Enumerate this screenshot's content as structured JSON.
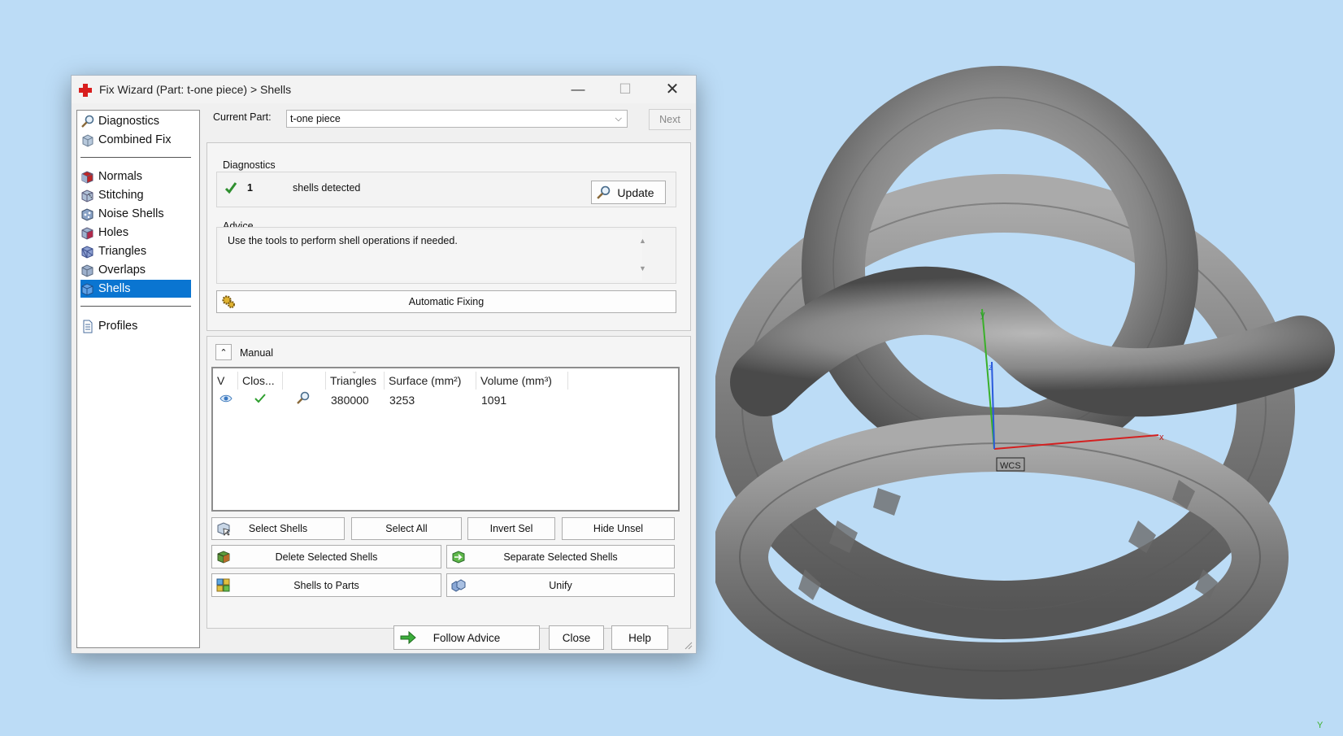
{
  "window": {
    "title": "Fix Wizard (Part: t-one piece) > Shells",
    "controls": {
      "minimize": "—",
      "maximize": "☐",
      "close": "✕"
    }
  },
  "nav": {
    "top": [
      {
        "label": "Diagnostics",
        "icon": "magnifier-icon"
      },
      {
        "label": "Combined Fix",
        "icon": "cube-stack-icon"
      }
    ],
    "tools": [
      {
        "label": "Normals",
        "icon": "normals-cube-icon"
      },
      {
        "label": "Stitching",
        "icon": "stitching-cube-icon"
      },
      {
        "label": "Noise Shells",
        "icon": "noise-shells-icon"
      },
      {
        "label": "Holes",
        "icon": "holes-cube-icon"
      },
      {
        "label": "Triangles",
        "icon": "triangles-cube-icon"
      },
      {
        "label": "Overlaps",
        "icon": "overlaps-cube-icon"
      },
      {
        "label": "Shells",
        "icon": "shells-cube-icon",
        "selected": true
      }
    ],
    "bottom": [
      {
        "label": "Profiles",
        "icon": "document-icon"
      }
    ]
  },
  "current_part": {
    "label": "Current Part:",
    "value": "t-one piece",
    "next": "Next"
  },
  "diagnostics": {
    "heading": "Diagnostics",
    "count": "1",
    "message": "shells detected",
    "update_button": "Update"
  },
  "advice": {
    "heading": "Advice",
    "text": "Use the tools to perform shell operations if needed."
  },
  "automatic_fixing": "Automatic Fixing",
  "manual": {
    "heading": "Manual",
    "columns": [
      "V",
      "Clos...",
      "",
      "Triangles",
      "Surface (mm²)",
      "Volume (mm³)"
    ],
    "rows": [
      {
        "triangles": "380000",
        "surface": "3253",
        "volume": "1091"
      }
    ],
    "buttons": {
      "select_shells": "Select Shells",
      "select_all": "Select All",
      "invert_sel": "Invert Sel",
      "hide_unsel": "Hide Unsel",
      "delete_selected": "Delete Selected Shells",
      "separate_selected": "Separate Selected Shells",
      "shells_to_parts": "Shells to Parts",
      "unify": "Unify"
    }
  },
  "footer": {
    "follow_advice": "Follow Advice",
    "close": "Close",
    "help": "Help"
  },
  "viewport": {
    "axis_x": "x",
    "axis_y": "y",
    "axis_z": "z",
    "wcs": "WCS",
    "corner_axis": "Y"
  }
}
